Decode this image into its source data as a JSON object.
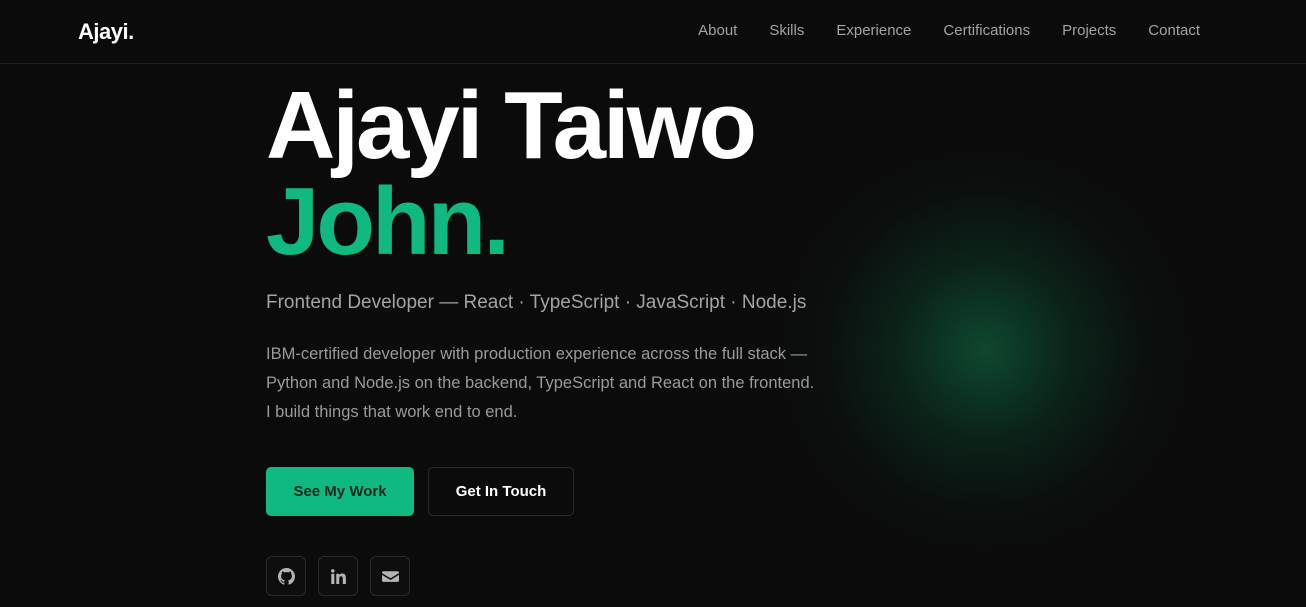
{
  "header": {
    "logo": "Ajayi.",
    "nav": [
      "About",
      "Skills",
      "Experience",
      "Certifications",
      "Projects",
      "Contact"
    ]
  },
  "hero": {
    "name_line1": "Ajayi Taiwo",
    "name_line2": "John.",
    "role": "Frontend Developer — React · TypeScript · JavaScript · Node.js",
    "bio_lines": [
      "IBM-certified developer with production experience across the full stack —",
      "Python and Node.js on the backend, TypeScript and React on the frontend.",
      "I build things that work end to end."
    ],
    "primary_cta": "See My Work",
    "secondary_cta": "Get In Touch",
    "socials": [
      "github-icon",
      "linkedin-icon",
      "mail-icon"
    ]
  },
  "colors": {
    "background": "#0b0b0b",
    "accent": "#10b981",
    "muted_text": "#a3a3a3"
  }
}
